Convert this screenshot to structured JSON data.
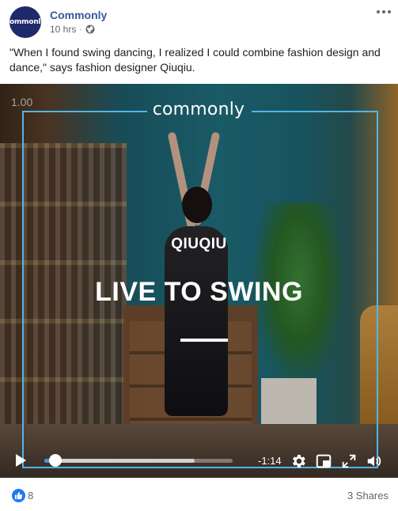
{
  "post": {
    "page_name": "Commonly",
    "avatar_text": "commonly",
    "time": "10 hrs",
    "privacy_icon": "globe-icon",
    "more_icon": "more-options-icon",
    "caption": "\"When I found swing dancing, I realized I could combine fashion design and dance,\" says fashion designer Qiuqiu."
  },
  "video": {
    "playback_rate": "1.00",
    "brand": "commonly",
    "subject": "QIUQIU",
    "headline": "LIVE TO SWING",
    "frame_color": "#4fb6e8",
    "progress": 0.06,
    "buffered": 0.8,
    "time_remaining": "-1:14",
    "controls": {
      "play_icon": "play-icon",
      "settings_icon": "gear-icon",
      "pip_icon": "picture-in-picture-icon",
      "fullscreen_icon": "fullscreen-icon",
      "volume_icon": "volume-icon"
    }
  },
  "footer": {
    "like_icon": "thumbs-up-icon",
    "like_count": "8",
    "shares": "3 Shares",
    "like_color": "#2078f4",
    "link_color": "#385898"
  }
}
